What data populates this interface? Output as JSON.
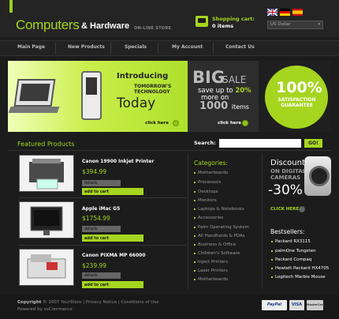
{
  "header": {
    "logo_main": "Computers",
    "logo_amp": "& Hardware",
    "logo_sub": "ON-LINE STORE",
    "cart_label": "Shopping cart:",
    "cart_items": "0 items",
    "currency": "US Dollar"
  },
  "nav": [
    "Main Page",
    "New Products",
    "Specials",
    "My Account",
    "Contact Us"
  ],
  "banner1": {
    "line1": "Introducing",
    "line2": "TOMORROW'S",
    "line3": "TECHNOLOGY",
    "line4": "Today",
    "link": "click here"
  },
  "banner2": {
    "big": "BIG",
    "sale": "SALE",
    "save_pre": "save up to",
    "save_pct": "20%",
    "more": "more on",
    "count": "1000",
    "items": "items",
    "link": "click here"
  },
  "banner3": {
    "percent": "100%",
    "line1": "SATISFACTION",
    "line2": "GUARANTEE"
  },
  "featured_title": "Featured Products",
  "search": {
    "label": "Search:",
    "placeholder": "",
    "button": "GO!"
  },
  "products": [
    {
      "name": "Canon 19900 Inkjet Printer",
      "price": "$394.99",
      "details": "details",
      "add": "add to cart"
    },
    {
      "name": "Apple iMac G5",
      "price": "$1754.99",
      "details": "details",
      "add": "add to cart"
    },
    {
      "name": "Canon PIXMA MP 66000",
      "price": "$239.99",
      "details": "details",
      "add": "add to cart"
    }
  ],
  "categories": {
    "title": "Categories:",
    "items": [
      "Motherboards",
      "Processors",
      "Desktops",
      "Monitors",
      "Laptops & Notebooks",
      "Accessories",
      "Palm Operating System",
      "All Handhelds & PDAs",
      "Business & Office",
      "Children's Software",
      "Inject Printers",
      "Laser Printers",
      "Motherboards"
    ]
  },
  "discount": {
    "title": "Discounts",
    "line1": "ON DIGITAL",
    "line2": "CAMERAS",
    "pct": "-30%",
    "link": "CLICK HERE"
  },
  "bestsellers": {
    "title": "Bestsellers:",
    "items": [
      "Packard RX3115",
      "palmOne Tungsten",
      "Packard Compaq",
      "Hewlett Packard HX4705",
      "Logitech Marble Mouse"
    ]
  },
  "footer": {
    "copy_label": "Copyright",
    "copy": "© 2007 YourStore | Privacy Notice | Conditions of Use",
    "powered": "Powered by osCommerce",
    "paypal": "PayPal",
    "visa": "VISA",
    "mc": "MasterCard"
  },
  "colors": {
    "accent": "#a6d51f",
    "bg": "#1c1c1c"
  }
}
